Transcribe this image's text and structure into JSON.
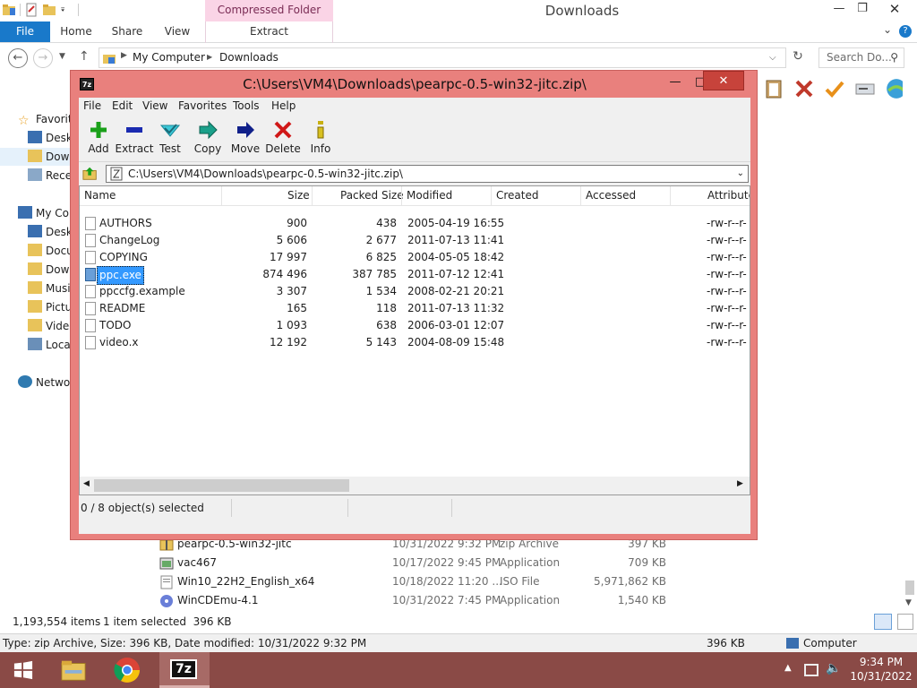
{
  "explorer": {
    "title": "Downloads",
    "contextual_tab": "Compressed Folder Tools",
    "ribbon_tabs": [
      "File",
      "Home",
      "Share",
      "View"
    ],
    "contextual_subtab": "Extract",
    "breadcrumb": [
      "My Computer",
      "Downloads"
    ],
    "search_placeholder": "Search Do...",
    "nav": [
      {
        "label": "Favorites",
        "icon": "star-icon"
      },
      {
        "label": "Desktop",
        "icon": "desktop-icon"
      },
      {
        "label": "Downloads",
        "icon": "downloads-folder-icon"
      },
      {
        "label": "Recent places",
        "icon": "recent-places-icon"
      },
      {
        "label": "My Computer",
        "icon": "computer-icon"
      },
      {
        "label": "Desktop",
        "icon": "desktop-icon"
      },
      {
        "label": "Documents",
        "icon": "documents-icon"
      },
      {
        "label": "Downloads",
        "icon": "downloads-folder-icon"
      },
      {
        "label": "Music",
        "icon": "music-icon"
      },
      {
        "label": "Pictures",
        "icon": "pictures-icon"
      },
      {
        "label": "Videos",
        "icon": "videos-icon"
      },
      {
        "label": "Local Disk",
        "icon": "local-disk-icon"
      },
      {
        "label": "Network",
        "icon": "network-icon"
      }
    ],
    "files": [
      {
        "name": "pearpc-0.5-win32-jitc",
        "date": "10/31/2022 9:32 PM",
        "type": "zip Archive",
        "size": "397 KB"
      },
      {
        "name": "vac467",
        "date": "10/17/2022 9:45 PM",
        "type": "Application",
        "size": "709 KB"
      },
      {
        "name": "Win10_22H2_English_x64",
        "date": "10/18/2022 11:20 ...",
        "type": "ISO File",
        "size": "5,971,862 KB"
      },
      {
        "name": "WinCDEmu-4.1",
        "date": "10/31/2022 7:45 PM",
        "type": "Application",
        "size": "1,540 KB"
      }
    ],
    "status_items": "1,193,554 items",
    "status_selected": "1 item selected  396 KB",
    "details_text": "Type: zip Archive, Size: 396 KB, Date modified: 10/31/2022 9:32 PM",
    "details_size": "396 KB",
    "details_location": "Computer"
  },
  "zip": {
    "title": "C:\\Users\\VM4\\Downloads\\pearpc-0.5-win32-jitc.zip\\",
    "menu": [
      "File",
      "Edit",
      "View",
      "Favorites",
      "Tools",
      "Help"
    ],
    "tools": [
      "Add",
      "Extract",
      "Test",
      "Copy",
      "Move",
      "Delete",
      "Info"
    ],
    "path": "C:\\Users\\VM4\\Downloads\\pearpc-0.5-win32-jitc.zip\\",
    "columns": [
      "Name",
      "Size",
      "Packed Size",
      "Modified",
      "Created",
      "Accessed",
      "Attributes"
    ],
    "rows": [
      {
        "name": "AUTHORS",
        "size": "900",
        "packed": "438",
        "modified": "2005-04-19 16:55",
        "attr": "-rw-r--r-"
      },
      {
        "name": "ChangeLog",
        "size": "5 606",
        "packed": "2 677",
        "modified": "2011-07-13 11:41",
        "attr": "-rw-r--r-"
      },
      {
        "name": "COPYING",
        "size": "17 997",
        "packed": "6 825",
        "modified": "2004-05-05 18:42",
        "attr": "-rw-r--r-"
      },
      {
        "name": "ppc.exe",
        "size": "874 496",
        "packed": "387 785",
        "modified": "2011-07-12 12:41",
        "attr": "-rw-r--r-"
      },
      {
        "name": "ppccfg.example",
        "size": "3 307",
        "packed": "1 534",
        "modified": "2008-02-21 20:21",
        "attr": "-rw-r--r-"
      },
      {
        "name": "README",
        "size": "165",
        "packed": "118",
        "modified": "2011-07-13 11:32",
        "attr": "-rw-r--r-"
      },
      {
        "name": "TODO",
        "size": "1 093",
        "packed": "638",
        "modified": "2006-03-01 12:07",
        "attr": "-rw-r--r-"
      },
      {
        "name": "video.x",
        "size": "12 192",
        "packed": "5 143",
        "modified": "2004-08-09 15:48",
        "attr": "-rw-r--r-"
      }
    ],
    "status": "0 / 8 object(s) selected"
  },
  "taskbar": {
    "time": "9:34 PM",
    "date": "10/31/2022"
  },
  "colors": {
    "zip_frame": "#e9807d",
    "accent_blue": "#1979ca",
    "selection": "#3399ff",
    "taskbar": "#8a4a46"
  }
}
